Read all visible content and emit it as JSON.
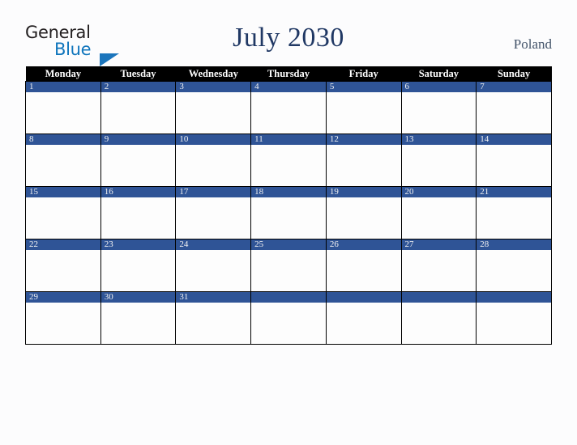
{
  "brand": {
    "name_part1": "General",
    "name_part2": "Blue",
    "triangle_icon": "triangle-right-icon",
    "accent_color": "#1b75bc",
    "text_color": "#231f20"
  },
  "header": {
    "title": "July 2030",
    "location": "Poland",
    "title_color": "#203864",
    "location_color": "#44546a"
  },
  "calendar": {
    "month": "July",
    "year": "2030",
    "week_start": "Monday",
    "header_bg": "#000000",
    "header_fg": "#ffffff",
    "day_bar_bg": "#2f5496",
    "day_bar_fg": "#f2f2f2",
    "cell_bg": "#fdfdfd",
    "border_color": "#000000",
    "day_headers": [
      "Monday",
      "Tuesday",
      "Wednesday",
      "Thursday",
      "Friday",
      "Saturday",
      "Sunday"
    ],
    "weeks": [
      {
        "days": [
          "1",
          "2",
          "3",
          "4",
          "5",
          "6",
          "7"
        ]
      },
      {
        "days": [
          "8",
          "9",
          "10",
          "11",
          "12",
          "13",
          "14"
        ]
      },
      {
        "days": [
          "15",
          "16",
          "17",
          "18",
          "19",
          "20",
          "21"
        ]
      },
      {
        "days": [
          "22",
          "23",
          "24",
          "25",
          "26",
          "27",
          "28"
        ]
      },
      {
        "days": [
          "29",
          "30",
          "31",
          "",
          "",
          "",
          ""
        ]
      }
    ]
  }
}
